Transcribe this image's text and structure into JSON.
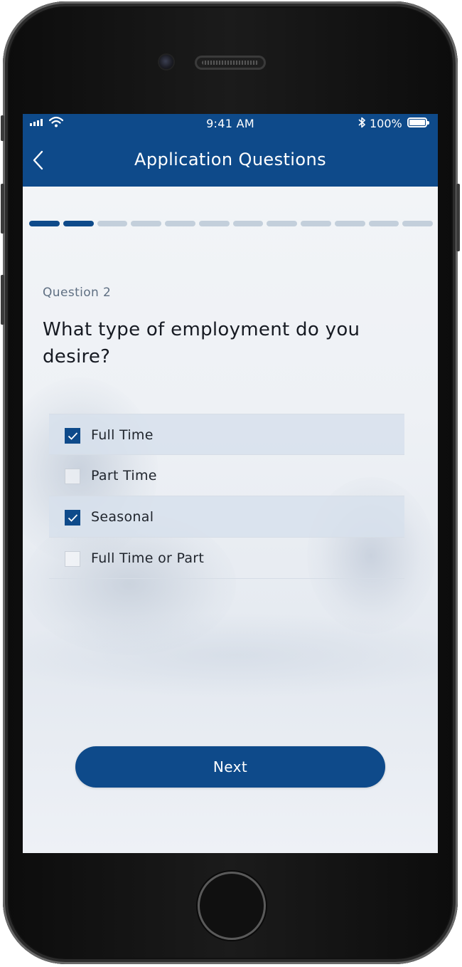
{
  "status_bar": {
    "time": "9:41 AM",
    "battery_percent": "100%",
    "icons": [
      "signal-icon",
      "wifi-icon",
      "bluetooth-icon",
      "battery-icon"
    ]
  },
  "nav": {
    "title": "Application Questions",
    "back_icon": "chevron-left-icon"
  },
  "progress": {
    "total_steps": 12,
    "completed_steps": 2
  },
  "question": {
    "number_label": "Question 2",
    "text": "What type of employment do you desire?"
  },
  "options": [
    {
      "label": "Full Time",
      "checked": true
    },
    {
      "label": "Part Time",
      "checked": false
    },
    {
      "label": "Seasonal",
      "checked": true
    },
    {
      "label": "Full Time or Part",
      "checked": false
    }
  ],
  "next_button": {
    "label": "Next"
  },
  "colors": {
    "primary": "#0e4a8a",
    "progress_inactive": "#c3cfdb",
    "selected_row": "#d7e0ec"
  }
}
